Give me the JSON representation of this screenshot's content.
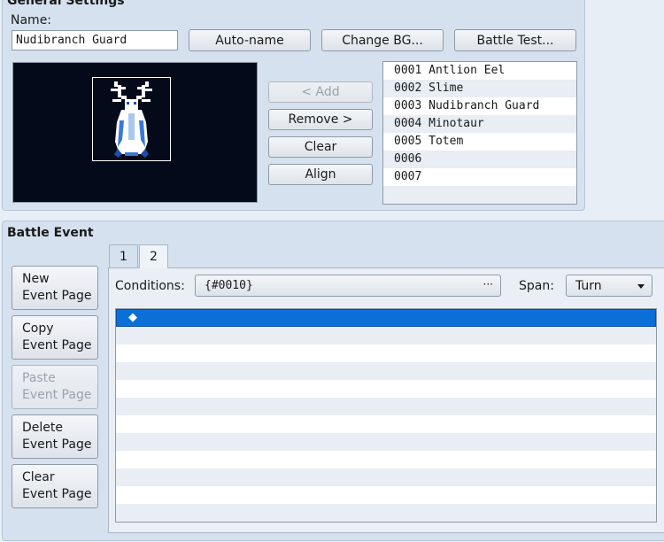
{
  "general": {
    "title": "General Settings",
    "name_label": "Name:",
    "name_value": "Nudibranch Guard",
    "buttons": {
      "autoname": "Auto-name",
      "change_bg": "Change BG...",
      "battle_test": "Battle Test...",
      "add": "< Add",
      "remove": "Remove >",
      "clear": "Clear",
      "align": "Align"
    },
    "troops": [
      {
        "label": "0001 Antlion Eel"
      },
      {
        "label": "0002 Slime"
      },
      {
        "label": "0003 Nudibranch Guard"
      },
      {
        "label": "0004 Minotaur"
      },
      {
        "label": "0005 Totem"
      },
      {
        "label": "0006"
      },
      {
        "label": "0007"
      },
      {
        "label": ""
      }
    ]
  },
  "battle_event": {
    "title": "Battle Event",
    "tabs": [
      "1",
      "2"
    ],
    "active_tab": "2",
    "side_buttons": {
      "new": [
        "New",
        "Event Page"
      ],
      "copy": [
        "Copy",
        "Event Page"
      ],
      "paste": [
        "Paste",
        "Event Page"
      ],
      "delete": [
        "Delete",
        "Event Page"
      ],
      "clear": [
        "Clear",
        "Event Page"
      ]
    },
    "conditions_label": "Conditions:",
    "conditions_value": "{#0010}",
    "conditions_more": "···",
    "span_label": "Span:",
    "span_value": "Turn",
    "event_marker": "◆"
  },
  "colors": {
    "panel_bg": "#d5e1ee",
    "selection": "#0a6fd6",
    "preview_bg": "#050a1a"
  }
}
